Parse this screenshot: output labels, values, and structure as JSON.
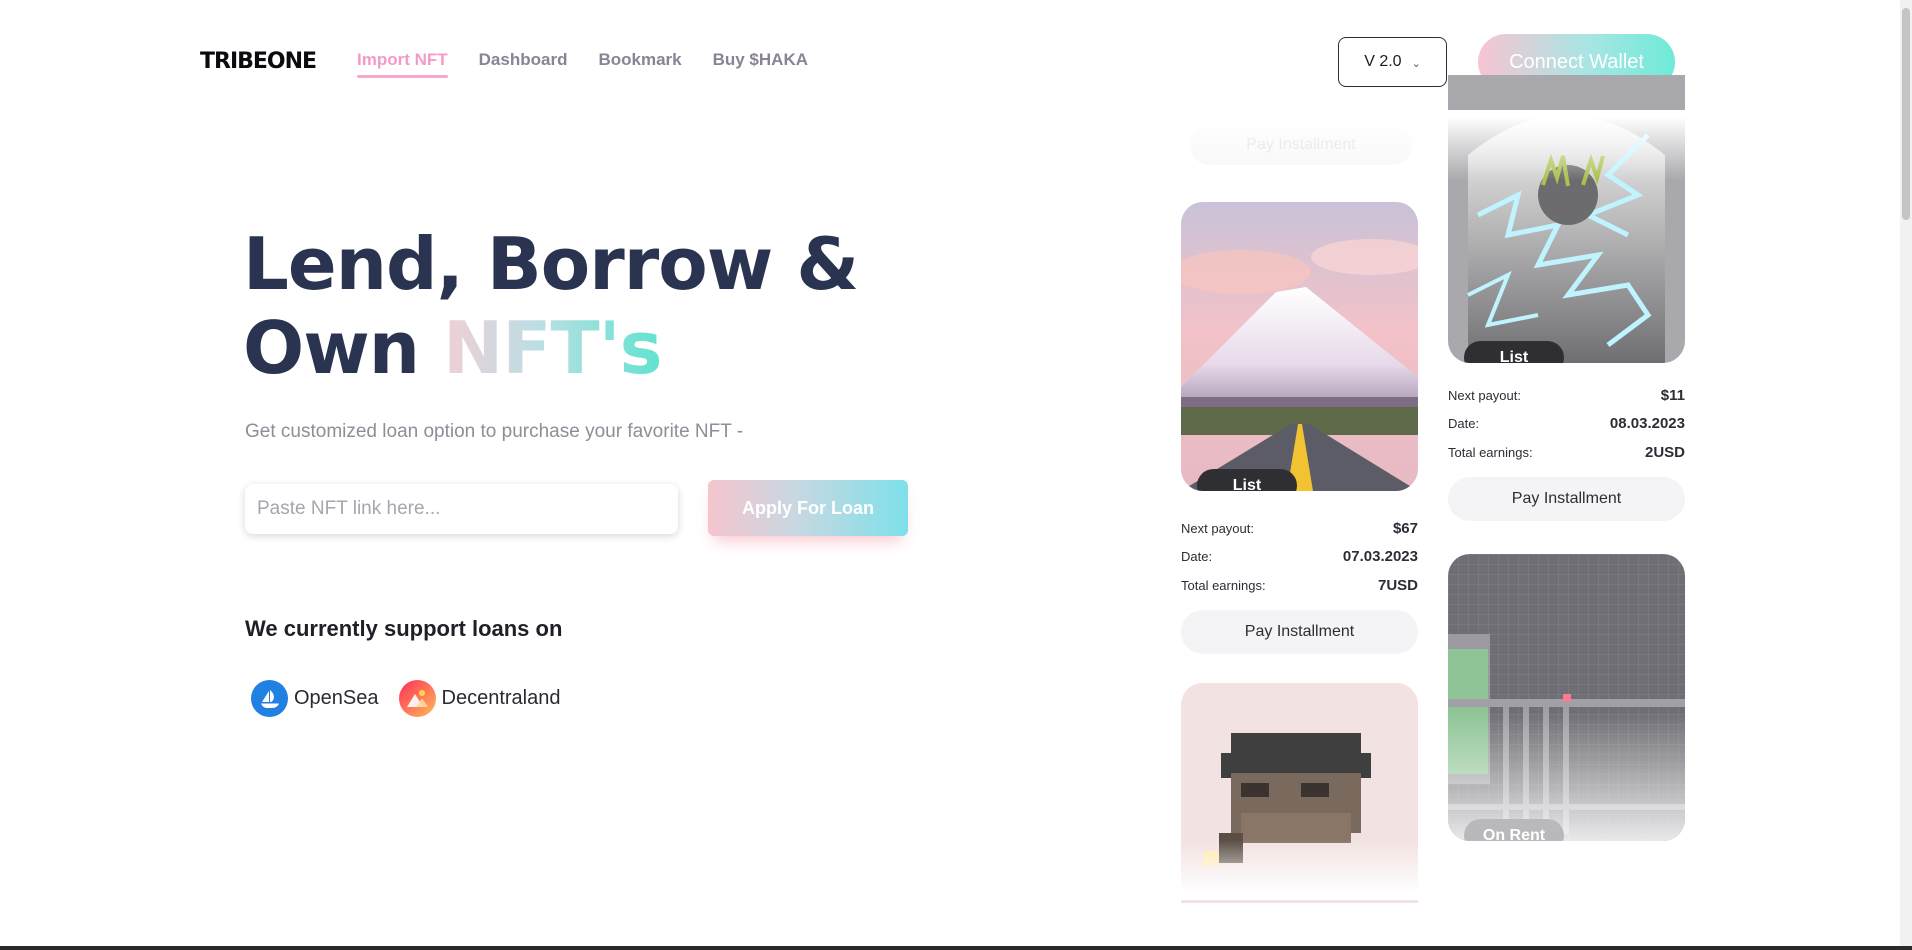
{
  "header": {
    "logo": "TRIBEONE",
    "nav": [
      "Import NFT",
      "Dashboard",
      "Bookmark",
      "Buy $HAKA"
    ],
    "active_nav": "Import NFT",
    "version": "V 2.0",
    "connect": "Connect Wallet"
  },
  "hero": {
    "title_line1": "Lend, Borrow &",
    "title_line2_prefix": "Own ",
    "title_line2_highlight": "NFT's",
    "subtitle": "Get customized loan option to purchase your favorite NFT -",
    "input_placeholder": "Paste NFT link here...",
    "apply_button": "Apply For Loan"
  },
  "support": {
    "title": "We currently support loans on",
    "platforms": [
      {
        "name": "OpenSea",
        "icon": "opensea-icon"
      },
      {
        "name": "Decentraland",
        "icon": "decentraland-icon"
      }
    ]
  },
  "cards": {
    "ghost_button": "Pay Installment",
    "labels": {
      "next_payout": "Next payout:",
      "date": "Date:",
      "total_earnings": "Total earnings:"
    },
    "left": [
      {
        "badge": "List",
        "next_payout": "$67",
        "date": "07.03.2023",
        "total_earnings": "7USD",
        "button": "Pay Installment"
      },
      {
        "badge": ""
      }
    ],
    "right": [
      {
        "badge": "List",
        "next_payout": "$11",
        "date": "08.03.2023",
        "total_earnings": "2USD",
        "button": "Pay Installment"
      },
      {
        "badge": "On Rent"
      }
    ]
  },
  "colors": {
    "title": "#2a3450",
    "nav_active": "#f39bc8",
    "nav": "#8a8395",
    "badge_dark": "#2e2e33"
  }
}
